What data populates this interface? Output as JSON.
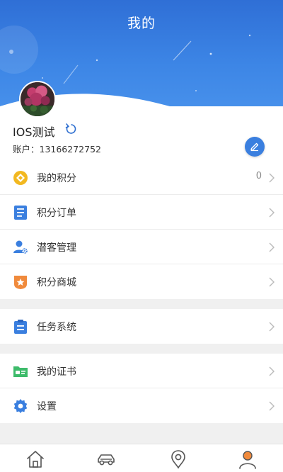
{
  "header": {
    "title": "我的"
  },
  "profile": {
    "username": "IOS测试",
    "account": "账户：13166272752"
  },
  "menu_group_1": [
    {
      "label": "我的积分",
      "value": "0",
      "icon": "points-diamond-icon"
    },
    {
      "label": "积分订单",
      "value": "",
      "icon": "order-list-icon"
    },
    {
      "label": "潜客管理",
      "value": "",
      "icon": "customer-manage-icon"
    },
    {
      "label": "积分商城",
      "value": "",
      "icon": "star-shield-icon"
    }
  ],
  "menu_group_2": [
    {
      "label": "任务系统",
      "value": "",
      "icon": "clipboard-icon"
    }
  ],
  "menu_group_3": [
    {
      "label": "我的证书",
      "value": "",
      "icon": "certificate-icon"
    },
    {
      "label": "设置",
      "value": "",
      "icon": "gear-icon"
    }
  ],
  "bottom_nav": [
    {
      "name": "home-icon"
    },
    {
      "name": "car-icon"
    },
    {
      "name": "location-bulb-icon"
    },
    {
      "name": "user-icon",
      "active": true
    }
  ],
  "colors": {
    "header_blue": "#3d86e6",
    "accent_blue": "#3a7fdf",
    "orange": "#f08a3c",
    "green": "#3dbb6a"
  }
}
